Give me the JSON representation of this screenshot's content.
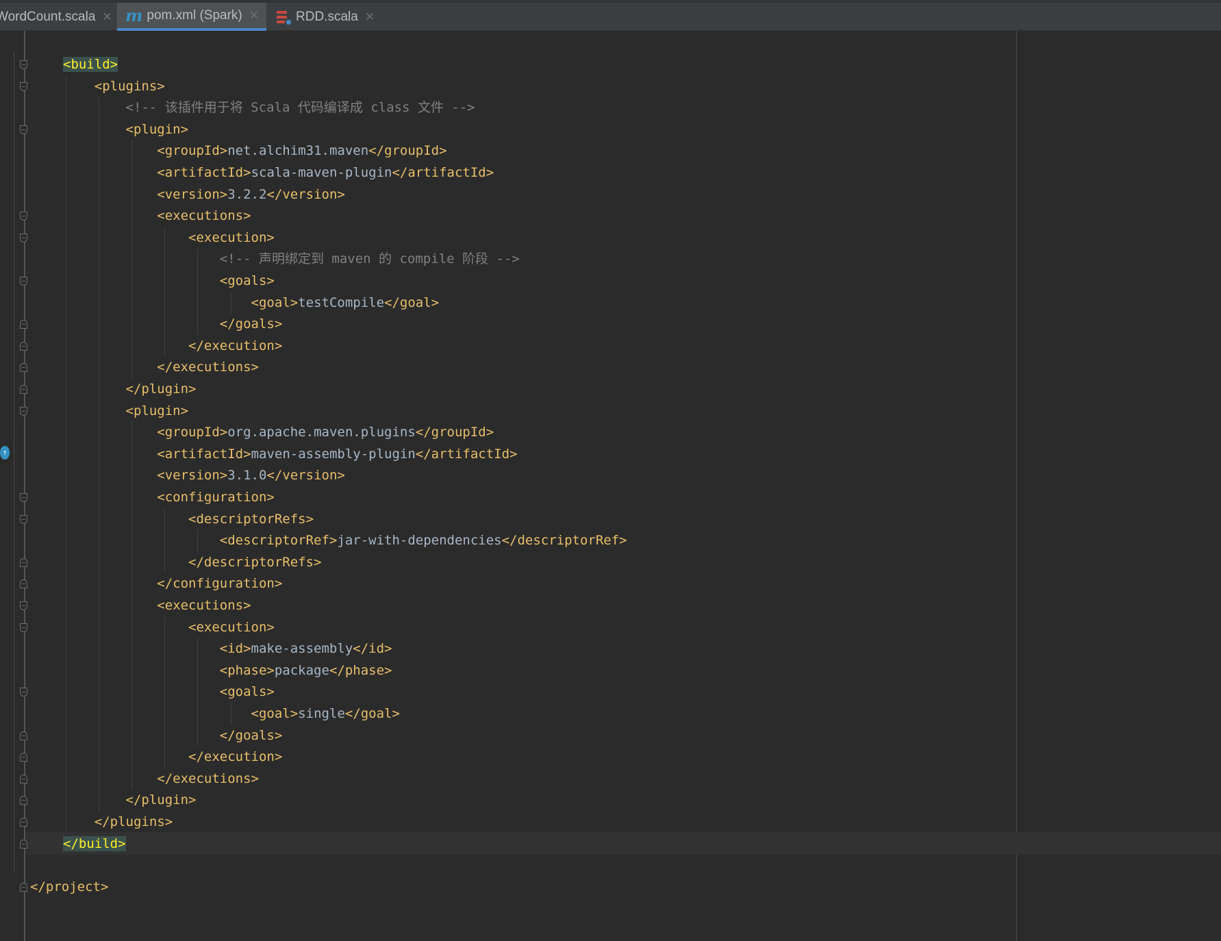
{
  "tabs": [
    {
      "label": "WordCount.scala",
      "icon": "scala-file-icon",
      "active": false
    },
    {
      "label": "pom.xml (Spark)",
      "icon": "maven-m-icon",
      "active": true
    },
    {
      "label": "RDD.scala",
      "icon": "scala-file-icon",
      "active": false
    }
  ],
  "colors": {
    "background": "#2b2b2b",
    "tag": "#e8bf6a",
    "text": "#a9b7c6",
    "comment": "#808080",
    "active_tab_underline": "#4a88c7"
  },
  "code": {
    "lines": [
      {
        "indent": "",
        "segments": [
          {
            "t": "tag",
            "v": "<build>"
          }
        ]
      },
      {
        "indent": "    ",
        "segments": [
          {
            "t": "tag",
            "v": "<plugins>"
          }
        ]
      },
      {
        "indent": "        ",
        "segments": [
          {
            "t": "cmt",
            "v": "<!-- 该插件用于将 Scala 代码编译成 class 文件 -->"
          }
        ]
      },
      {
        "indent": "        ",
        "segments": [
          {
            "t": "tag",
            "v": "<plugin>"
          }
        ]
      },
      {
        "indent": "            ",
        "segments": [
          {
            "t": "tag",
            "v": "<groupId>"
          },
          {
            "t": "txt",
            "v": "net.alchim31.maven"
          },
          {
            "t": "tag",
            "v": "</groupId>"
          }
        ]
      },
      {
        "indent": "            ",
        "segments": [
          {
            "t": "tag",
            "v": "<artifactId>"
          },
          {
            "t": "txt",
            "v": "scala-maven-plugin"
          },
          {
            "t": "tag",
            "v": "</artifactId>"
          }
        ]
      },
      {
        "indent": "            ",
        "segments": [
          {
            "t": "tag",
            "v": "<version>"
          },
          {
            "t": "txt",
            "v": "3.2.2"
          },
          {
            "t": "tag",
            "v": "</version>"
          }
        ]
      },
      {
        "indent": "            ",
        "segments": [
          {
            "t": "tag",
            "v": "<executions>"
          }
        ]
      },
      {
        "indent": "                ",
        "segments": [
          {
            "t": "tag",
            "v": "<execution>"
          }
        ]
      },
      {
        "indent": "                    ",
        "segments": [
          {
            "t": "cmt",
            "v": "<!-- 声明绑定到 maven 的 compile 阶段 -->"
          }
        ]
      },
      {
        "indent": "                    ",
        "segments": [
          {
            "t": "tag",
            "v": "<goals>"
          }
        ]
      },
      {
        "indent": "                        ",
        "segments": [
          {
            "t": "tag",
            "v": "<goal>"
          },
          {
            "t": "txt",
            "v": "testCompile"
          },
          {
            "t": "tag",
            "v": "</goal>"
          }
        ]
      },
      {
        "indent": "                    ",
        "segments": [
          {
            "t": "tag",
            "v": "</goals>"
          }
        ]
      },
      {
        "indent": "                ",
        "segments": [
          {
            "t": "tag",
            "v": "</execution>"
          }
        ]
      },
      {
        "indent": "            ",
        "segments": [
          {
            "t": "tag",
            "v": "</executions>"
          }
        ]
      },
      {
        "indent": "        ",
        "segments": [
          {
            "t": "tag",
            "v": "</plugin>"
          }
        ]
      },
      {
        "indent": "        ",
        "segments": [
          {
            "t": "tag",
            "v": "<plugin>"
          }
        ]
      },
      {
        "indent": "            ",
        "segments": [
          {
            "t": "tag",
            "v": "<groupId>"
          },
          {
            "t": "txt",
            "v": "org.apache.maven.plugins"
          },
          {
            "t": "tag",
            "v": "</groupId>"
          }
        ]
      },
      {
        "indent": "            ",
        "segments": [
          {
            "t": "tag",
            "v": "<artifactId>"
          },
          {
            "t": "txt",
            "v": "maven-assembly-plugin"
          },
          {
            "t": "tag",
            "v": "</artifactId>"
          }
        ]
      },
      {
        "indent": "            ",
        "segments": [
          {
            "t": "tag",
            "v": "<version>"
          },
          {
            "t": "txt",
            "v": "3.1.0"
          },
          {
            "t": "tag",
            "v": "</version>"
          }
        ]
      },
      {
        "indent": "            ",
        "segments": [
          {
            "t": "tag",
            "v": "<configuration>"
          }
        ]
      },
      {
        "indent": "                ",
        "segments": [
          {
            "t": "tag",
            "v": "<descriptorRefs>"
          }
        ]
      },
      {
        "indent": "                    ",
        "segments": [
          {
            "t": "tag",
            "v": "<descriptorRef>"
          },
          {
            "t": "txt",
            "v": "jar-with-dependencies"
          },
          {
            "t": "tag",
            "v": "</descriptorRef>"
          }
        ]
      },
      {
        "indent": "                ",
        "segments": [
          {
            "t": "tag",
            "v": "</descriptorRefs>"
          }
        ]
      },
      {
        "indent": "            ",
        "segments": [
          {
            "t": "tag",
            "v": "</configuration>"
          }
        ]
      },
      {
        "indent": "            ",
        "segments": [
          {
            "t": "tag",
            "v": "<executions>"
          }
        ]
      },
      {
        "indent": "                ",
        "segments": [
          {
            "t": "tag",
            "v": "<execution>"
          }
        ]
      },
      {
        "indent": "                    ",
        "segments": [
          {
            "t": "tag",
            "v": "<id>"
          },
          {
            "t": "txt",
            "v": "make-assembly"
          },
          {
            "t": "tag",
            "v": "</id>"
          }
        ]
      },
      {
        "indent": "                    ",
        "segments": [
          {
            "t": "tag",
            "v": "<phase>"
          },
          {
            "t": "txt",
            "v": "package"
          },
          {
            "t": "tag",
            "v": "</phase>"
          }
        ]
      },
      {
        "indent": "                    ",
        "segments": [
          {
            "t": "tag",
            "v": "<goals>"
          }
        ]
      },
      {
        "indent": "                        ",
        "segments": [
          {
            "t": "tag",
            "v": "<goal>"
          },
          {
            "t": "txt",
            "v": "single"
          },
          {
            "t": "tag",
            "v": "</goal>"
          }
        ]
      },
      {
        "indent": "                    ",
        "segments": [
          {
            "t": "tag",
            "v": "</goals>"
          }
        ]
      },
      {
        "indent": "                ",
        "segments": [
          {
            "t": "tag",
            "v": "</execution>"
          }
        ]
      },
      {
        "indent": "            ",
        "segments": [
          {
            "t": "tag",
            "v": "</executions>"
          }
        ]
      },
      {
        "indent": "        ",
        "segments": [
          {
            "t": "tag",
            "v": "</plugin>"
          }
        ]
      },
      {
        "indent": "    ",
        "segments": [
          {
            "t": "tag",
            "v": "</plugins>"
          }
        ]
      },
      {
        "indent": "",
        "segments": [
          {
            "t": "tag",
            "v": "</build>"
          }
        ]
      },
      {
        "indent": "",
        "segments": []
      },
      {
        "indent": "",
        "segments": [
          {
            "t": "tag",
            "v": "</project>"
          }
        ]
      }
    ]
  }
}
